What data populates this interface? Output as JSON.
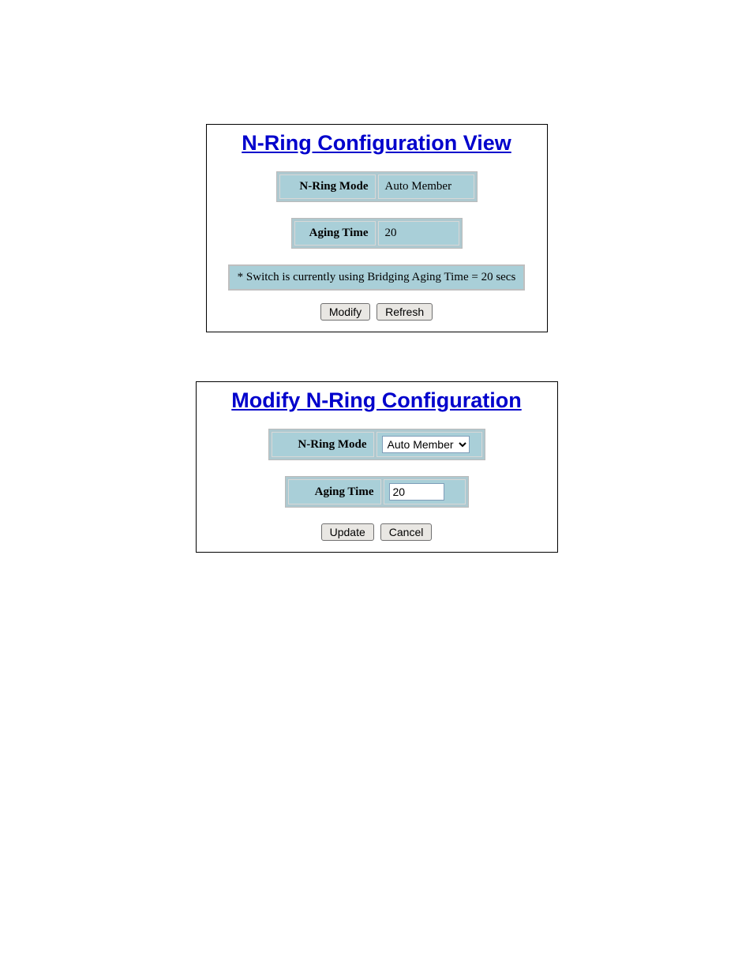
{
  "view": {
    "title": "N-Ring Configuration View",
    "mode_label": "N-Ring Mode",
    "mode_value": "Auto Member",
    "aging_label": "Aging Time",
    "aging_value": "20",
    "status_text": "* Switch is currently using Bridging Aging Time = 20 secs",
    "modify_btn": "Modify",
    "refresh_btn": "Refresh"
  },
  "modify": {
    "title": "Modify N-Ring Configuration",
    "mode_label": "N-Ring Mode",
    "mode_selected": "Auto Member",
    "aging_label": "Aging Time",
    "aging_value": "20",
    "update_btn": "Update",
    "cancel_btn": "Cancel"
  }
}
